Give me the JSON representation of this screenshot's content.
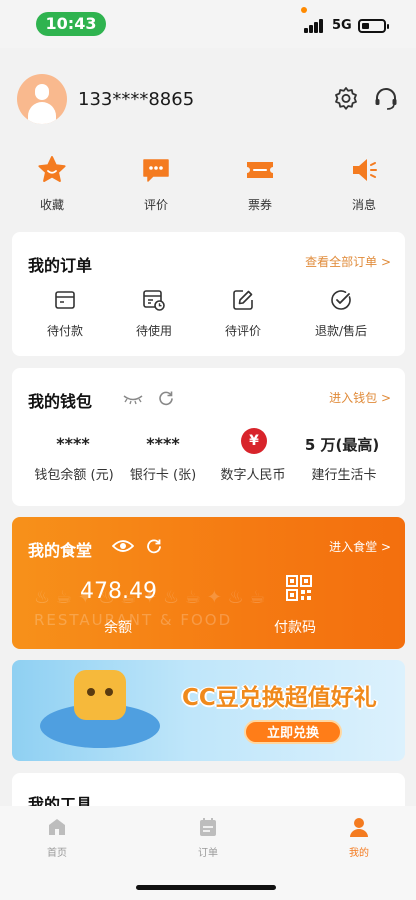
{
  "status_bar": {
    "time": "10:43",
    "network": "5G"
  },
  "profile": {
    "phone": "133****8865"
  },
  "quick_actions": [
    {
      "label": "收藏",
      "icon": "star-icon"
    },
    {
      "label": "评价",
      "icon": "chat-bubble-icon"
    },
    {
      "label": "票券",
      "icon": "ticket-icon"
    },
    {
      "label": "消息",
      "icon": "speaker-icon"
    }
  ],
  "orders": {
    "title": "我的订单",
    "view_all": "查看全部订单 >",
    "items": [
      {
        "label": "待付款",
        "icon": "wallet-card-icon"
      },
      {
        "label": "待使用",
        "icon": "calendar-clock-icon"
      },
      {
        "label": "待评价",
        "icon": "edit-pencil-icon"
      },
      {
        "label": "退款/售后",
        "icon": "check-circle-icon"
      }
    ]
  },
  "wallet": {
    "title": "我的钱包",
    "enter": "进入钱包 >",
    "items": [
      {
        "value": "****",
        "label": "钱包余额 (元)"
      },
      {
        "value": "****",
        "label": "银行卡 (张)"
      },
      {
        "value": "",
        "label": "数字人民币",
        "icon": "yuan-badge-icon"
      },
      {
        "value": "5 万(最高)",
        "label": "建行生活卡"
      }
    ],
    "rmb_symbol": "¥"
  },
  "canteen": {
    "title": "我的食堂",
    "enter": "进入食堂 >",
    "amount": "478.49",
    "amount_label": "余额",
    "pay_code_label": "付款码",
    "deco_text": "RESTAURANT & FOOD"
  },
  "banner": {
    "title": "CC豆兑换超值好礼",
    "button": "立即兑换"
  },
  "tools": {
    "title": "我的工具"
  },
  "tab_bar": [
    {
      "label": "首页",
      "icon": "home-icon",
      "active": false
    },
    {
      "label": "订单",
      "icon": "order-calendar-icon",
      "active": false
    },
    {
      "label": "我的",
      "icon": "person-icon",
      "active": true
    }
  ],
  "colors": {
    "accent": "#f47b20",
    "canteen_bg": "#f7911a",
    "status_green": "#2fb34f",
    "rmb_red": "#d8242b"
  }
}
